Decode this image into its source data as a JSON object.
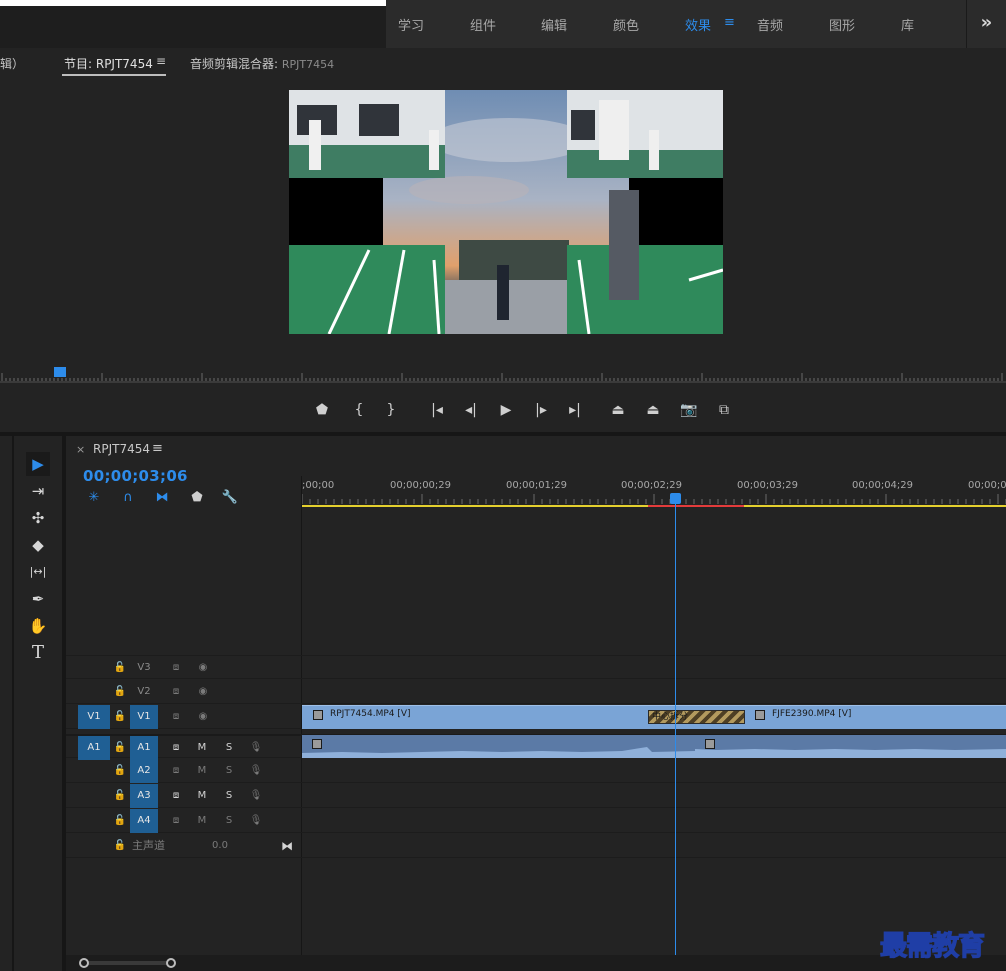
{
  "workspaces": {
    "tabs": [
      {
        "label": "学习"
      },
      {
        "label": "组件"
      },
      {
        "label": "编辑"
      },
      {
        "label": "颜色"
      },
      {
        "label": "效果"
      },
      {
        "label": "音频"
      },
      {
        "label": "图形"
      },
      {
        "label": "库"
      }
    ],
    "active_menu": "≡",
    "more": "»"
  },
  "monitor": {
    "left_tab_fragment": "辑）",
    "program_tab": "节目: RPJT7454",
    "program_menu": "≡",
    "audio_mixer_tab": "音频剪辑混合器:",
    "audio_mixer_seq": "RPJT7454"
  },
  "transport": {
    "buttons": [
      {
        "name": "add-marker",
        "glyph": "⬟"
      },
      {
        "name": "mark-in",
        "glyph": "{"
      },
      {
        "name": "mark-out",
        "glyph": "}"
      },
      {
        "name": "go-to-in",
        "glyph": "|◂"
      },
      {
        "name": "step-back",
        "glyph": "◂|"
      },
      {
        "name": "play",
        "glyph": "▶"
      },
      {
        "name": "step-forward",
        "glyph": "|▸"
      },
      {
        "name": "go-to-out",
        "glyph": "▸|"
      },
      {
        "name": "lift",
        "glyph": "⏏"
      },
      {
        "name": "extract",
        "glyph": "⏏"
      },
      {
        "name": "export-frame",
        "glyph": "📷"
      },
      {
        "name": "comparison-view",
        "glyph": "⧉"
      }
    ]
  },
  "tools": [
    {
      "name": "selection-tool",
      "glyph": "▶",
      "active": true
    },
    {
      "name": "track-select-tool",
      "glyph": "⇥"
    },
    {
      "name": "ripple-edit-tool",
      "glyph": "✣"
    },
    {
      "name": "razor-tool",
      "glyph": "◆"
    },
    {
      "name": "slip-tool",
      "glyph": "|↔|"
    },
    {
      "name": "pen-tool",
      "glyph": "✒"
    },
    {
      "name": "hand-tool",
      "glyph": "✋"
    },
    {
      "name": "type-tool",
      "glyph": "T"
    }
  ],
  "sequence": {
    "close": "×",
    "name": "RPJT7454",
    "menu": "≡",
    "timecode": "00;00;03;06"
  },
  "ruler": {
    "labels": [
      ";00;00",
      "00;00;00;29",
      "00;00;01;29",
      "00;00;02;29",
      "00;00;03;29",
      "00;00;04;29",
      "00;00;0"
    ]
  },
  "tracks": {
    "video": [
      {
        "name": "V3",
        "source": ""
      },
      {
        "name": "V2",
        "source": ""
      },
      {
        "name": "V1",
        "source": "V1"
      }
    ],
    "audio": [
      {
        "name": "A1",
        "source": "A1",
        "m": "M",
        "s": "S"
      },
      {
        "name": "A2",
        "source": "",
        "m": "M",
        "s": "S"
      },
      {
        "name": "A3",
        "source": "",
        "m": "M",
        "s": "S"
      },
      {
        "name": "A4",
        "source": "",
        "m": "M",
        "s": "S"
      }
    ],
    "master": {
      "label": "主声道",
      "value": "0.0"
    }
  },
  "clips": {
    "v1_clip1": "RPJT7454.MP4 [V]",
    "v1_clip2": "FJFE2390.MP4 [V]",
    "transition": "中心拆分"
  },
  "watermark": "最需教育",
  "colors": {
    "accent": "#2d8ceb",
    "video_clip": "#7aa4d6",
    "audio_clip": "#5b7aa6",
    "work_area": "#e4d02e",
    "render_bar": "#e33b3b"
  }
}
